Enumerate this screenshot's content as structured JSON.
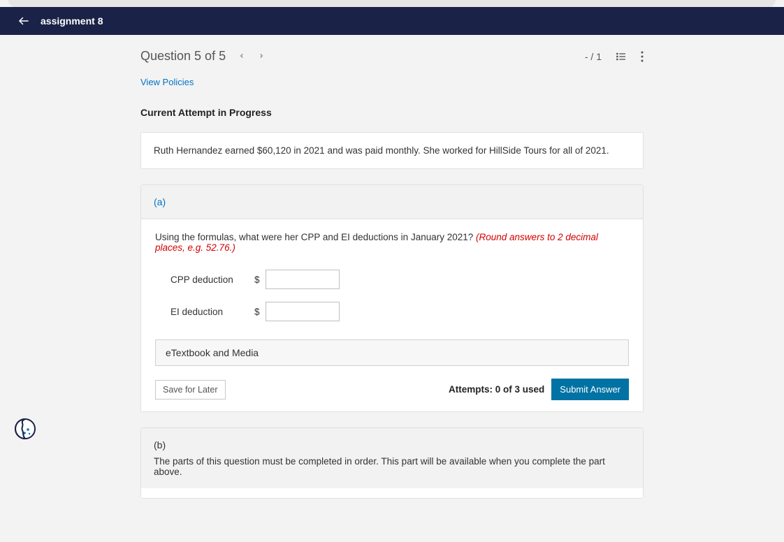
{
  "header": {
    "title": "assignment 8"
  },
  "questionBar": {
    "title": "Question 5 of 5",
    "score": "- / 1"
  },
  "policiesLink": "View Policies",
  "attemptLabel": "Current Attempt in Progress",
  "intro": "Ruth Hernandez earned $60,120 in 2021 and was paid monthly. She worked for HillSide Tours for all of 2021.",
  "partA": {
    "label": "(a)",
    "question": "Using the formulas, what were her CPP and EI deductions in January 2021? ",
    "hint": "(Round answers to 2 decimal places, e.g. 52.76.)",
    "fields": {
      "cpp": {
        "label": "CPP deduction",
        "currency": "$",
        "value": ""
      },
      "ei": {
        "label": "EI deduction",
        "currency": "$",
        "value": ""
      }
    },
    "resourcesLabel": "eTextbook and Media",
    "saveLabel": "Save for Later",
    "attemptsText": "Attempts: 0 of 3 used",
    "submitLabel": "Submit Answer"
  },
  "partB": {
    "label": "(b)",
    "message": "The parts of this question must be completed in order. This part will be available when you complete the part above."
  }
}
